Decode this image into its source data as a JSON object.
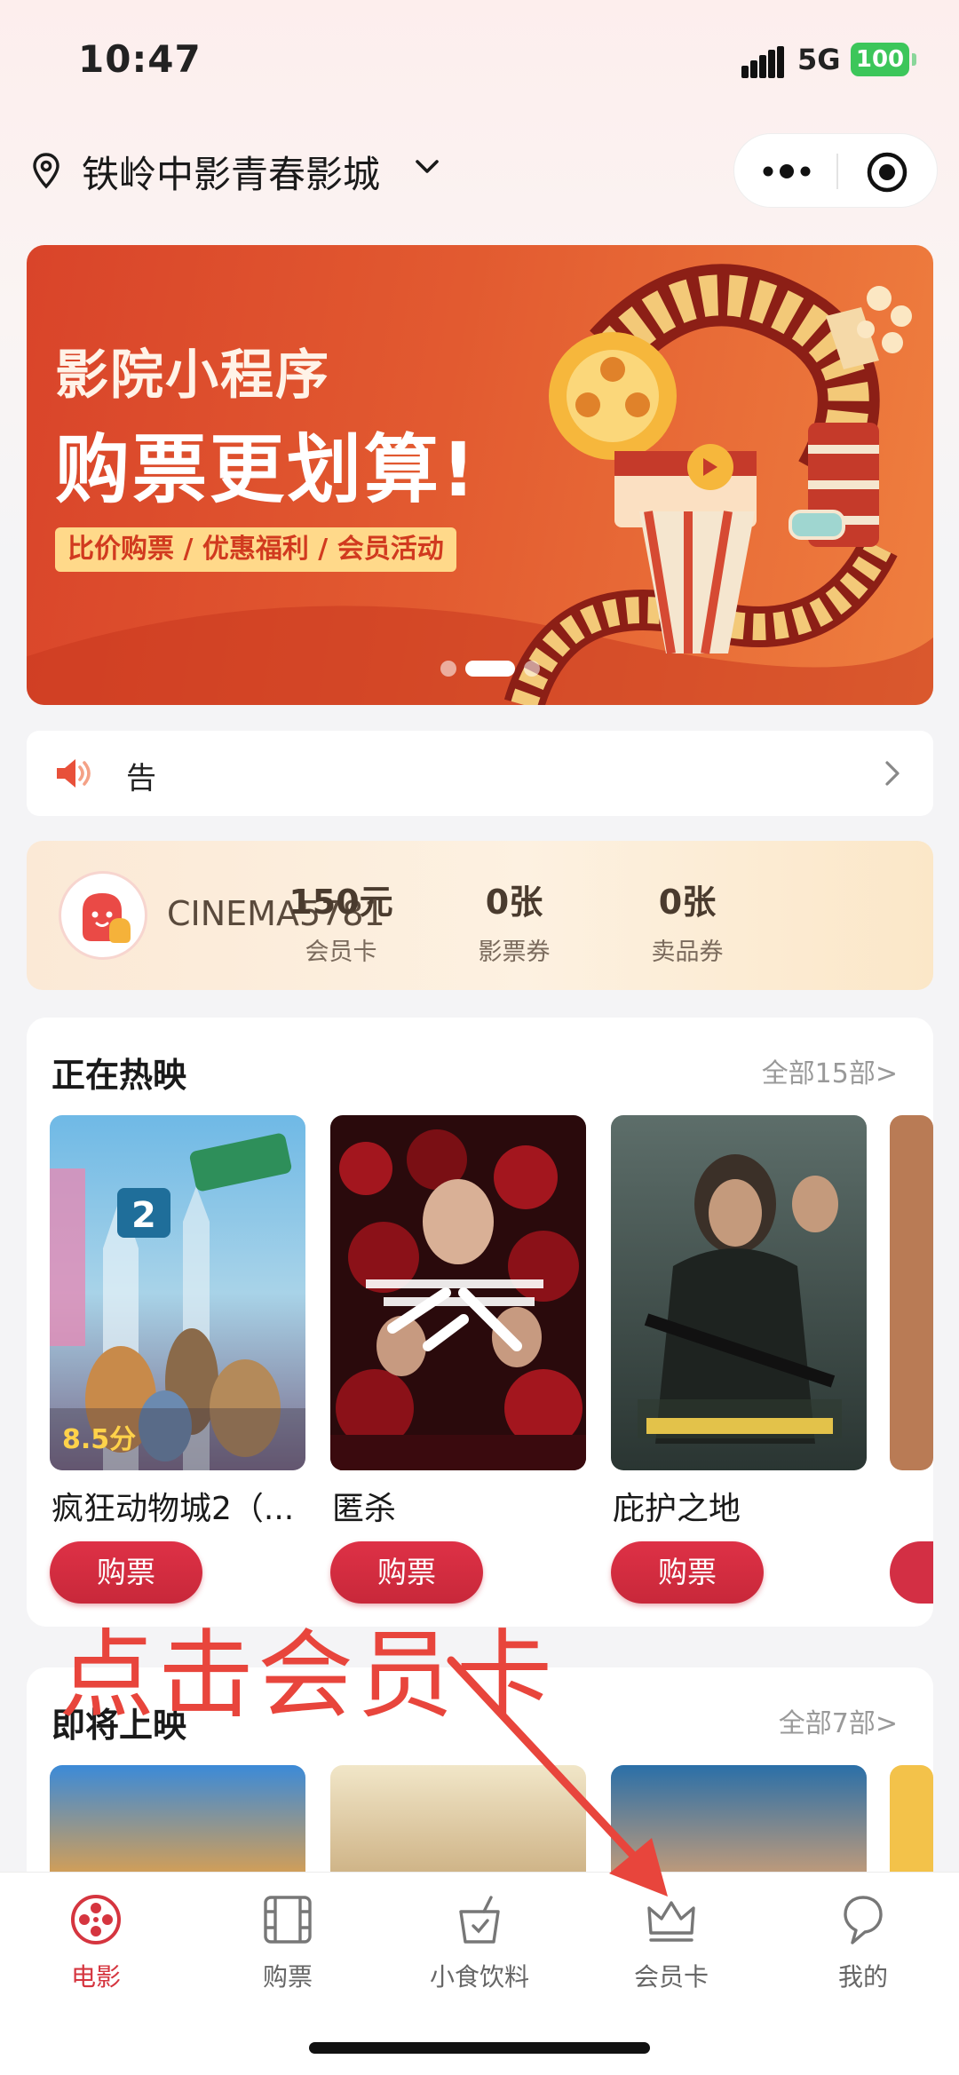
{
  "status_bar": {
    "time": "10:47",
    "network": "5G",
    "battery": "100"
  },
  "location": {
    "cinema_name": "铁岭中影青春影城"
  },
  "banner": {
    "line1": "影院小程序",
    "line2": "购票更划算!",
    "tag": "比价购票 / 优惠福利 / 会员活动",
    "active_slide": 2,
    "slide_count": 3
  },
  "notice": {
    "text": "告"
  },
  "member": {
    "name": "CINEMA5781",
    "stats": [
      {
        "value": "150元",
        "label": "会员卡"
      },
      {
        "value": "0张",
        "label": "影票券"
      },
      {
        "value": "0张",
        "label": "卖品券"
      }
    ]
  },
  "now_showing": {
    "title": "正在热映",
    "more": "全部15部>",
    "movies": [
      {
        "title": "疯狂动物城2（...",
        "score": "8.5分",
        "buy_label": "购票"
      },
      {
        "title": "匿杀",
        "buy_label": "购票"
      },
      {
        "title": "庇护之地",
        "buy_label": "购票"
      }
    ]
  },
  "upcoming": {
    "title": "即将上映",
    "more": "全部7部>"
  },
  "annotation": {
    "text": "点击会员卡",
    "color": "#e8453c"
  },
  "tabbar": {
    "tabs": [
      {
        "label": "电影",
        "icon": "film-reel-icon",
        "active": true
      },
      {
        "label": "购票",
        "icon": "film-strip-icon"
      },
      {
        "label": "小食饮料",
        "icon": "drink-cup-icon"
      },
      {
        "label": "会员卡",
        "icon": "crown-icon"
      },
      {
        "label": "我的",
        "icon": "person-icon"
      }
    ]
  },
  "colors": {
    "accent": "#d5353f",
    "buy_button": "#d32f44",
    "banner": "#e05530"
  }
}
